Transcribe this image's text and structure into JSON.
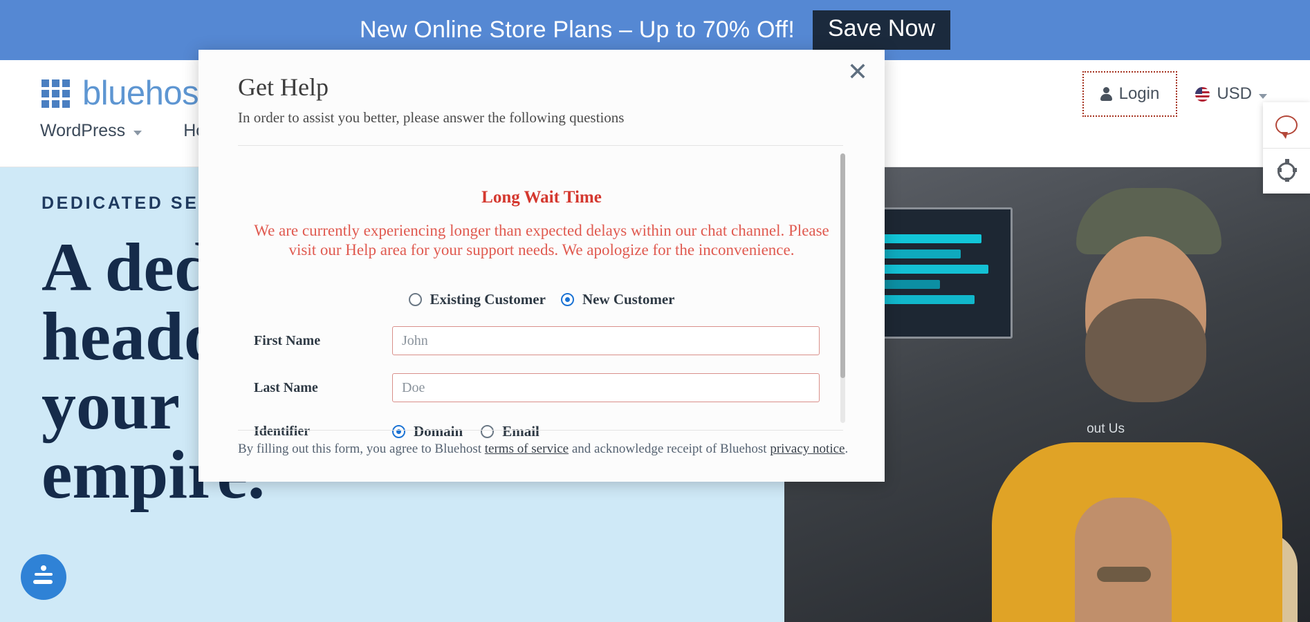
{
  "promo": {
    "text": "New Online Store Plans – Up to 70% Off!",
    "button_label": "Save Now",
    "bg_color": "#5588d3",
    "button_bg": "#1b2a3d"
  },
  "header": {
    "logo_text": "bluehost",
    "logo_icon": "grid-icon",
    "logo_color": "#5e96d2",
    "nav": [
      {
        "label": "WordPress",
        "icon": "chevron-down-icon"
      },
      {
        "label": "Hosting",
        "icon": "chevron-down-icon"
      }
    ],
    "login": {
      "label": "Login",
      "icon": "person-icon"
    },
    "currency": {
      "label": "USD",
      "icon": "us-flag-icon",
      "caret": "chevron-down-icon"
    }
  },
  "hero": {
    "eyebrow": "DEDICATED SERVERS",
    "headline_lines": [
      "A ded",
      "headq",
      "your o",
      "empire."
    ],
    "photo_caption": "out Us",
    "bg_color": "#cfe9f7",
    "accessibility_icon": "accessibility-icon"
  },
  "side_widgets": [
    {
      "name": "chat-widget",
      "icon": "chat-bubble-icon"
    },
    {
      "name": "settings-widget",
      "icon": "cog-icon"
    }
  ],
  "modal": {
    "title": "Get Help",
    "subtitle": "In order to assist you better, please answer the following questions",
    "close_icon": "close-icon",
    "alert": {
      "title": "Long Wait Time",
      "body": "We are currently experiencing longer than expected delays within our chat channel. Please visit our Help area for your support needs. We apologize for the inconvenience.",
      "title_color": "#d4382f",
      "body_color": "#e05a50"
    },
    "customer_type": {
      "options": [
        {
          "label": "Existing Customer",
          "selected": false
        },
        {
          "label": "New Customer",
          "selected": true
        }
      ]
    },
    "fields": [
      {
        "label": "First Name",
        "value": "",
        "placeholder": "John",
        "error": true
      },
      {
        "label": "Last Name",
        "value": "",
        "placeholder": "Doe",
        "error": true
      }
    ],
    "identifier": {
      "label": "Identifier",
      "options": [
        {
          "label": "Domain",
          "selected": true
        },
        {
          "label": "Email",
          "selected": false
        }
      ]
    },
    "footer": {
      "prefix": "By filling out this form, you agree to Bluehost ",
      "link1": "terms of service",
      "middle": " and acknowledge receipt of Bluehost ",
      "link2": "privacy notice",
      "suffix": "."
    }
  }
}
